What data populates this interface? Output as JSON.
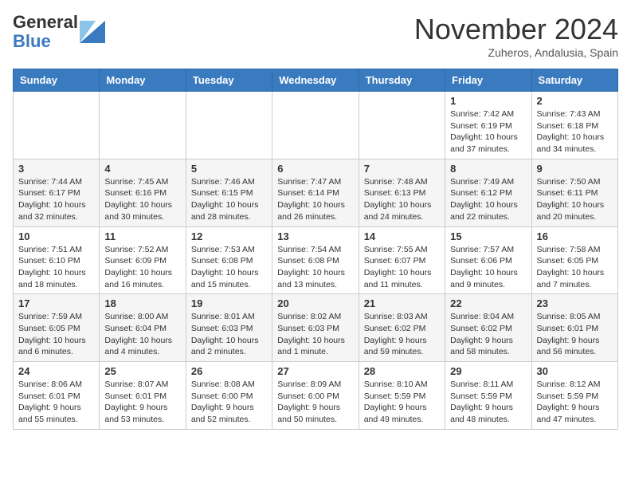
{
  "header": {
    "logo_general": "General",
    "logo_blue": "Blue",
    "month_title": "November 2024",
    "location": "Zuheros, Andalusia, Spain"
  },
  "weekdays": [
    "Sunday",
    "Monday",
    "Tuesday",
    "Wednesday",
    "Thursday",
    "Friday",
    "Saturday"
  ],
  "weeks": [
    [
      {
        "day": "",
        "info": ""
      },
      {
        "day": "",
        "info": ""
      },
      {
        "day": "",
        "info": ""
      },
      {
        "day": "",
        "info": ""
      },
      {
        "day": "",
        "info": ""
      },
      {
        "day": "1",
        "info": "Sunrise: 7:42 AM\nSunset: 6:19 PM\nDaylight: 10 hours and 37 minutes."
      },
      {
        "day": "2",
        "info": "Sunrise: 7:43 AM\nSunset: 6:18 PM\nDaylight: 10 hours and 34 minutes."
      }
    ],
    [
      {
        "day": "3",
        "info": "Sunrise: 7:44 AM\nSunset: 6:17 PM\nDaylight: 10 hours and 32 minutes."
      },
      {
        "day": "4",
        "info": "Sunrise: 7:45 AM\nSunset: 6:16 PM\nDaylight: 10 hours and 30 minutes."
      },
      {
        "day": "5",
        "info": "Sunrise: 7:46 AM\nSunset: 6:15 PM\nDaylight: 10 hours and 28 minutes."
      },
      {
        "day": "6",
        "info": "Sunrise: 7:47 AM\nSunset: 6:14 PM\nDaylight: 10 hours and 26 minutes."
      },
      {
        "day": "7",
        "info": "Sunrise: 7:48 AM\nSunset: 6:13 PM\nDaylight: 10 hours and 24 minutes."
      },
      {
        "day": "8",
        "info": "Sunrise: 7:49 AM\nSunset: 6:12 PM\nDaylight: 10 hours and 22 minutes."
      },
      {
        "day": "9",
        "info": "Sunrise: 7:50 AM\nSunset: 6:11 PM\nDaylight: 10 hours and 20 minutes."
      }
    ],
    [
      {
        "day": "10",
        "info": "Sunrise: 7:51 AM\nSunset: 6:10 PM\nDaylight: 10 hours and 18 minutes."
      },
      {
        "day": "11",
        "info": "Sunrise: 7:52 AM\nSunset: 6:09 PM\nDaylight: 10 hours and 16 minutes."
      },
      {
        "day": "12",
        "info": "Sunrise: 7:53 AM\nSunset: 6:08 PM\nDaylight: 10 hours and 15 minutes."
      },
      {
        "day": "13",
        "info": "Sunrise: 7:54 AM\nSunset: 6:08 PM\nDaylight: 10 hours and 13 minutes."
      },
      {
        "day": "14",
        "info": "Sunrise: 7:55 AM\nSunset: 6:07 PM\nDaylight: 10 hours and 11 minutes."
      },
      {
        "day": "15",
        "info": "Sunrise: 7:57 AM\nSunset: 6:06 PM\nDaylight: 10 hours and 9 minutes."
      },
      {
        "day": "16",
        "info": "Sunrise: 7:58 AM\nSunset: 6:05 PM\nDaylight: 10 hours and 7 minutes."
      }
    ],
    [
      {
        "day": "17",
        "info": "Sunrise: 7:59 AM\nSunset: 6:05 PM\nDaylight: 10 hours and 6 minutes."
      },
      {
        "day": "18",
        "info": "Sunrise: 8:00 AM\nSunset: 6:04 PM\nDaylight: 10 hours and 4 minutes."
      },
      {
        "day": "19",
        "info": "Sunrise: 8:01 AM\nSunset: 6:03 PM\nDaylight: 10 hours and 2 minutes."
      },
      {
        "day": "20",
        "info": "Sunrise: 8:02 AM\nSunset: 6:03 PM\nDaylight: 10 hours and 1 minute."
      },
      {
        "day": "21",
        "info": "Sunrise: 8:03 AM\nSunset: 6:02 PM\nDaylight: 9 hours and 59 minutes."
      },
      {
        "day": "22",
        "info": "Sunrise: 8:04 AM\nSunset: 6:02 PM\nDaylight: 9 hours and 58 minutes."
      },
      {
        "day": "23",
        "info": "Sunrise: 8:05 AM\nSunset: 6:01 PM\nDaylight: 9 hours and 56 minutes."
      }
    ],
    [
      {
        "day": "24",
        "info": "Sunrise: 8:06 AM\nSunset: 6:01 PM\nDaylight: 9 hours and 55 minutes."
      },
      {
        "day": "25",
        "info": "Sunrise: 8:07 AM\nSunset: 6:01 PM\nDaylight: 9 hours and 53 minutes."
      },
      {
        "day": "26",
        "info": "Sunrise: 8:08 AM\nSunset: 6:00 PM\nDaylight: 9 hours and 52 minutes."
      },
      {
        "day": "27",
        "info": "Sunrise: 8:09 AM\nSunset: 6:00 PM\nDaylight: 9 hours and 50 minutes."
      },
      {
        "day": "28",
        "info": "Sunrise: 8:10 AM\nSunset: 5:59 PM\nDaylight: 9 hours and 49 minutes."
      },
      {
        "day": "29",
        "info": "Sunrise: 8:11 AM\nSunset: 5:59 PM\nDaylight: 9 hours and 48 minutes."
      },
      {
        "day": "30",
        "info": "Sunrise: 8:12 AM\nSunset: 5:59 PM\nDaylight: 9 hours and 47 minutes."
      }
    ]
  ]
}
